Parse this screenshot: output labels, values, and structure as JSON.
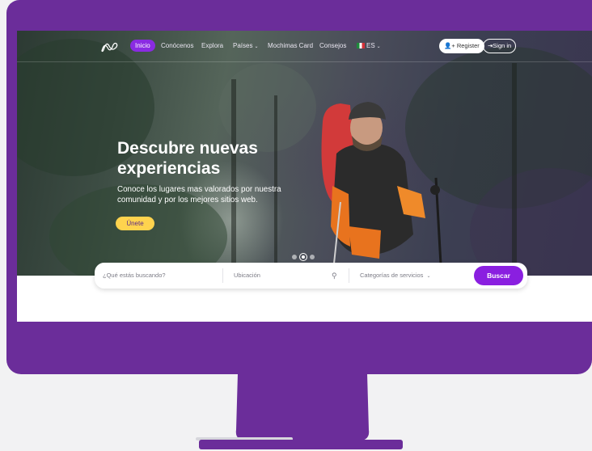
{
  "nav": {
    "items": [
      {
        "label": "Inicio",
        "active": true
      },
      {
        "label": "Conócenos"
      },
      {
        "label": "Explora"
      },
      {
        "label": "Países"
      },
      {
        "label": "Mochimas Card"
      },
      {
        "label": "Consejos"
      }
    ],
    "language": "ES",
    "register_label": "Register",
    "signin_label": "Sign in"
  },
  "hero": {
    "title": "Descubre nuevas experiencias",
    "subtitle": "Conoce los lugares mas valorados por nuestra comunidad y por los mejores sitios web.",
    "cta_label": "Únete",
    "slide_count": 3,
    "active_slide": 2
  },
  "search": {
    "query_placeholder": "¿Qué estás buscando?",
    "location_placeholder": "Ubicación",
    "category_placeholder": "Categorías de servicios",
    "button_label": "Buscar"
  },
  "colors": {
    "accent": "#8a1fe0",
    "monitor": "#6b2d9a",
    "cta": "#ffd34e"
  }
}
